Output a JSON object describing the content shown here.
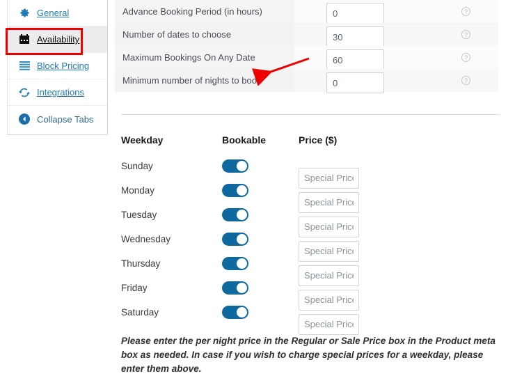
{
  "sidebar": {
    "items": [
      {
        "label": "General",
        "icon": "gear-icon",
        "active": false
      },
      {
        "label": "Availability",
        "icon": "calendar-icon",
        "active": true
      },
      {
        "label": "Block Pricing",
        "icon": "list-icon",
        "active": false
      },
      {
        "label": "Integrations",
        "icon": "sync-icon",
        "active": false
      },
      {
        "label": "Collapse Tabs",
        "icon": "collapse-left-icon",
        "active": false
      }
    ]
  },
  "settings": {
    "rows": [
      {
        "label": "Advance Booking Period (in hours)",
        "value": "0",
        "help": "?"
      },
      {
        "label": "Number of dates to choose",
        "value": "30",
        "help": "?"
      },
      {
        "label": "Maximum Bookings On Any Date",
        "value": "60",
        "help": "?"
      },
      {
        "label": "Minimum number of nights to book",
        "value": "0",
        "help": "?"
      }
    ]
  },
  "weekday_table": {
    "headers": {
      "weekday": "Weekday",
      "bookable": "Bookable",
      "price": "Price ($)"
    },
    "price_placeholder": "Special Price",
    "rows": [
      {
        "day": "Sunday",
        "bookable": true,
        "price": ""
      },
      {
        "day": "Monday",
        "bookable": true,
        "price": ""
      },
      {
        "day": "Tuesday",
        "bookable": true,
        "price": ""
      },
      {
        "day": "Wednesday",
        "bookable": true,
        "price": ""
      },
      {
        "day": "Thursday",
        "bookable": true,
        "price": ""
      },
      {
        "day": "Friday",
        "bookable": true,
        "price": ""
      },
      {
        "day": "Saturday",
        "bookable": true,
        "price": ""
      }
    ]
  },
  "note": "Please enter the per night price in the Regular or Sale Price box in the Product meta box as needed. In case if you wish to charge special prices for a weekday, please enter them above.",
  "annotations": {
    "highlight_color": "#ee0000",
    "arrow_color": "#ee0000"
  },
  "colors": {
    "accent": "#0e6a9e",
    "link": "#1f7cb8",
    "row_bg": "#f5f5f5"
  }
}
